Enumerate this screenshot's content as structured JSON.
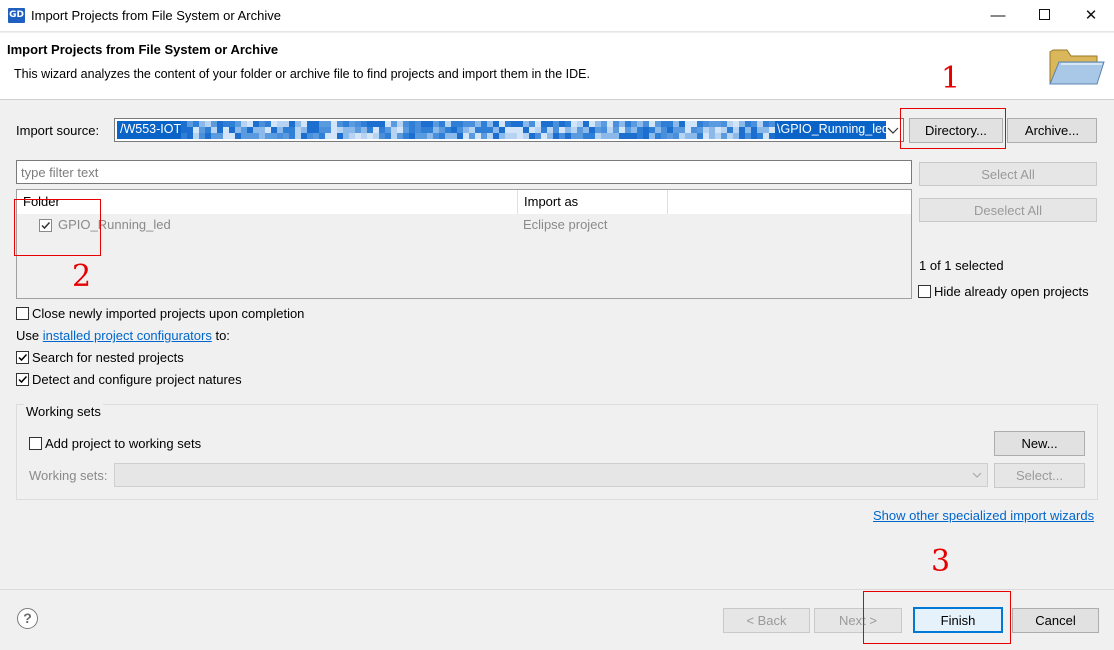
{
  "window": {
    "app_icon_text": "GD",
    "title": "Import Projects from File System or Archive",
    "minimize_glyph": "—",
    "close_glyph": "✕"
  },
  "header": {
    "title": "Import Projects from File System or Archive",
    "description": "This wizard analyzes the content of your folder or archive file to find projects and import them in the IDE.",
    "icon": "folder-icon"
  },
  "import_source": {
    "label": "Import source:",
    "value_start": "/W553-IOT",
    "value_end": "\\GPIO_Running_led",
    "selection_color": "#0a63c6",
    "directory_button": "Directory...",
    "archive_button": "Archive..."
  },
  "filter": {
    "placeholder": "type filter text"
  },
  "side_buttons": {
    "select_all": "Select All",
    "deselect_all": "Deselect All"
  },
  "table": {
    "columns": [
      "Folder",
      "Import as"
    ],
    "rows": [
      {
        "checked": true,
        "folder": "GPIO_Running_led",
        "import_as": "Eclipse project"
      }
    ]
  },
  "selection_status": "1 of 1 selected",
  "options": {
    "hide_open": {
      "label": "Hide already open projects",
      "checked": false
    },
    "close_imported": {
      "label": "Close newly imported projects upon completion",
      "checked": false
    },
    "use_prefix": "Use",
    "use_link": "installed project configurators",
    "use_suffix": "to:",
    "search_nested": {
      "label": "Search for nested projects",
      "checked": true
    },
    "detect_natures": {
      "label": "Detect and configure project natures",
      "checked": true
    }
  },
  "working_sets": {
    "group_title": "Working sets",
    "add_label": "Add project to working sets",
    "add_checked": false,
    "new_button": "New...",
    "sets_label": "Working sets:",
    "select_button": "Select..."
  },
  "show_other_link": "Show other specialized import wizards",
  "footer": {
    "help": "?",
    "back": "< Back",
    "next": "Next >",
    "finish": "Finish",
    "cancel": "Cancel"
  },
  "annotations": {
    "numbers": [
      "1",
      "2",
      "3"
    ],
    "color": "#e60000"
  }
}
